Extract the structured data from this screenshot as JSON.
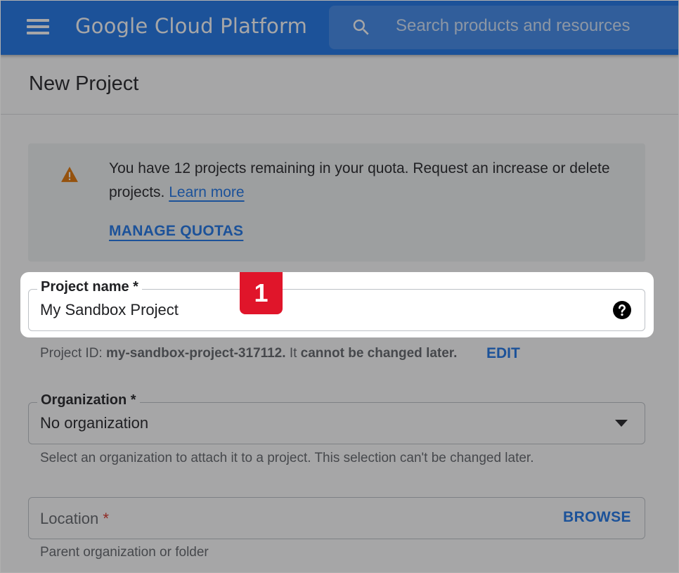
{
  "header": {
    "brand": "Google Cloud Platform",
    "search_placeholder": "Search products and resources",
    "color": "#1a73e8"
  },
  "page": {
    "title": "New Project"
  },
  "quota_notice": {
    "message": "You have 12 projects remaining in your quota. Request an increase or delete projects.",
    "learn_more": "Learn more",
    "manage_quotas": "MANAGE QUOTAS",
    "icon": "warning-icon"
  },
  "project_name": {
    "label": "Project name *",
    "value": "My Sandbox Project",
    "help_icon": "help-icon"
  },
  "project_id": {
    "prefix": "Project ID:",
    "id": "my-sandbox-project-317112.",
    "suffix_plain": "It",
    "suffix_bold": "cannot be changed later.",
    "edit": "EDIT"
  },
  "organization": {
    "label": "Organization *",
    "value": "No organization",
    "helper": "Select an organization to attach it to a project. This selection can't be changed later."
  },
  "location": {
    "label": "Location",
    "required_mark": "*",
    "browse": "BROWSE",
    "helper": "Parent organization or folder"
  },
  "step_badge": "1",
  "colors": {
    "accent": "#1a73e8",
    "warning": "#e37400",
    "badge": "#e0152a"
  }
}
